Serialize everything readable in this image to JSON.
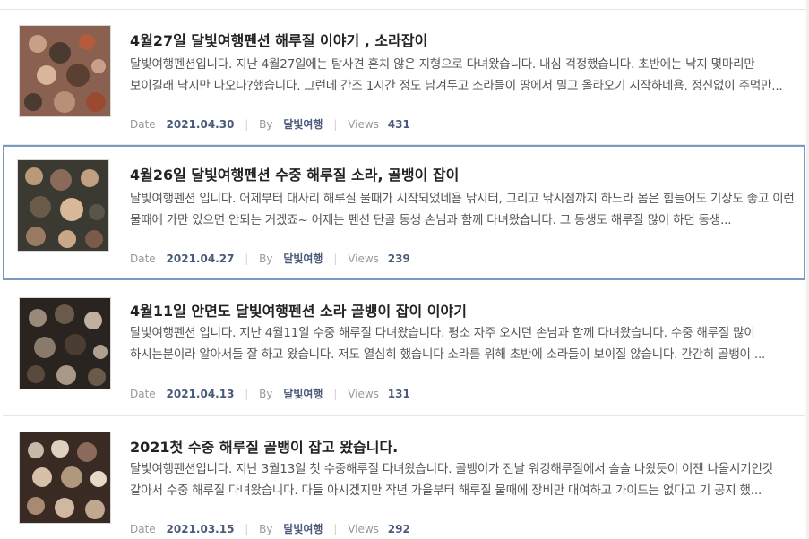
{
  "meta_labels": {
    "date": "Date",
    "by": "By",
    "views": "Views"
  },
  "posts": [
    {
      "title": "4월27일 달빛여행펜션 해루질 이야기 , 소라잡이",
      "excerpt": "달빛여행펜션입니다. 지난 4월27일에는 탐사견 흔치 않은 지형으로 다녀왔습니다. 내심 걱정했습니다. 초반에는 낙지 몇마리만 보이길래 낙지만 나오나?했습니다. 그런데 간조 1시간 정도 남겨두고 소라들이 땅에서 밀고 올라오기 시작하네욤. 정신없이 주먹만...",
      "date": "2021.04.30",
      "author": "달빛여행",
      "views": "431",
      "thumb_colors": [
        "#7a5a4a",
        "#c7a087",
        "#4a3a30",
        "#b55a3a"
      ]
    },
    {
      "title": "4월26일 달빛여행펜션 수중 해루질 소라, 골뱅이 잡이",
      "excerpt": "달빛여행펜션 입니다. 어제부터 대사리 해루질 물때가 시작되었네욤 낚시터, 그리고 낚시점까지 하느라 몸은 힘들어도 기상도 좋고 이런 물때에 가만 있으면 안되는 거겠죠~ 어제는 펜션 단골 동생 손님과 함께 다녀왔습니다. 그 동생도 해루질 많이 하던 동생...",
      "date": "2021.04.27",
      "author": "달빛여행",
      "views": "239",
      "thumb_colors": [
        "#3a3a32",
        "#b89a7a",
        "#5a5548",
        "#8a6a5a"
      ]
    },
    {
      "title": "4월11일 안면도 달빛여행펜션 소라 골뱅이 잡이 이야기",
      "excerpt": "달빛여행펜션 입니다. 지난 4월11일 수중 해루질 다녀왔습니다. 평소 자주 오시던 손님과 함께 다녀왔습니다. 수중 해루질 많이 하시는분이라 알아서들 잘 하고 왔습니다. 저도 열심히 했습니다 소라를 위해 초반에 소라들이 보이질 않습니다. 간간히 골뱅이 ...",
      "date": "2021.04.13",
      "author": "달빛여행",
      "views": "131",
      "thumb_colors": [
        "#2a2420",
        "#9a8a7a",
        "#6a5a4a",
        "#c0b0a0"
      ]
    },
    {
      "title": "2021첫 수중 해루질 골뱅이 잡고 왔습니다.",
      "excerpt": "달빛여행펜션입니다. 지난 3월13일 첫 수중해루질 다녀왔습니다. 골뱅이가 전날 워킹해루질에서 슬슬 나왔듯이 이젠 나올시기인것 같아서 수중 해루질 다녀왔습니다. 다들 아시겠지만 작년 가을부터 해루질 물때에 장비만 대여하고 가이드는 없다고 기 공지 했...",
      "date": "2021.03.15",
      "author": "달빛여행",
      "views": "292",
      "thumb_colors": [
        "#3a2a24",
        "#c8b8a8",
        "#8a6a5a",
        "#e0d0c0"
      ]
    }
  ]
}
